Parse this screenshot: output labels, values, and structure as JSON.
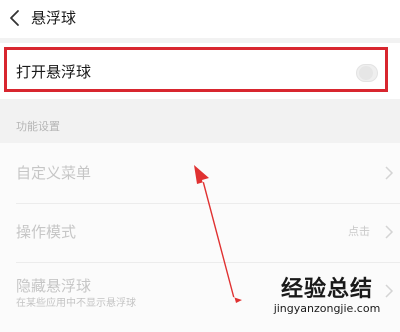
{
  "header": {
    "back_icon": "chevron-left-icon",
    "title": "悬浮球"
  },
  "toggle_row": {
    "label": "打开悬浮球",
    "enabled": false,
    "highlight_color": "#d8262f"
  },
  "section": {
    "label": "功能设置"
  },
  "items": [
    {
      "label": "自定义菜单",
      "icon": "chevron-right-icon"
    },
    {
      "label": "操作模式",
      "value": "点击",
      "icon": "chevron-right-icon"
    },
    {
      "label": "隐藏悬浮球",
      "sublabel": "在某些应用中不显示悬浮球",
      "icon": "chevron-right-icon"
    }
  ],
  "annotation": {
    "icon": "red-arrow-icon",
    "color": "#e03131"
  },
  "watermark": {
    "brand": "经验总结",
    "url": "jingyanzongjie.com"
  }
}
